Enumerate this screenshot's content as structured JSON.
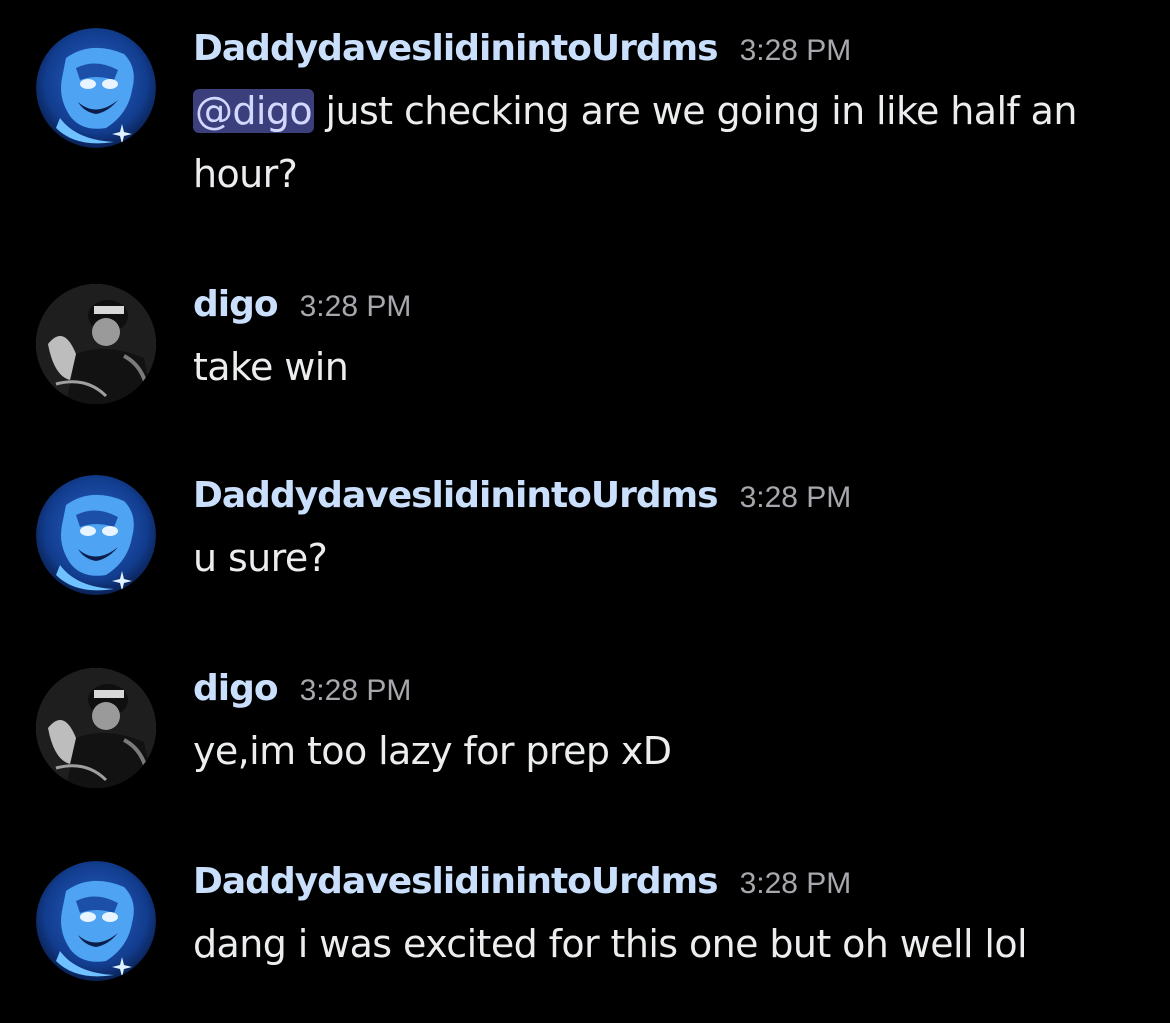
{
  "messages": [
    {
      "author": "DaddydaveslidinintoUrdms",
      "time": "3:28 PM",
      "mention": "@digo",
      "text": " just checking are we going in like half an hour?",
      "avatar": "blue-character-avatar"
    },
    {
      "author": "digo",
      "time": "3:28 PM",
      "text": "take win",
      "avatar": "grayscale-photo-avatar"
    },
    {
      "author": "DaddydaveslidinintoUrdms",
      "time": "3:28 PM",
      "text": "u sure?",
      "avatar": "blue-character-avatar"
    },
    {
      "author": "digo",
      "time": "3:28 PM",
      "text": "ye,im too lazy for prep xD",
      "avatar": "grayscale-photo-avatar"
    },
    {
      "author": "DaddydaveslidinintoUrdms",
      "time": "3:28 PM",
      "text": "dang i was excited for this one but oh well lol",
      "avatar": "blue-character-avatar"
    }
  ],
  "colors": {
    "background": "#000000",
    "username": "#c9dffb",
    "timestamp": "#a6a8ad",
    "message_text": "#ecedef",
    "mention_bg": "#3b3f7c"
  }
}
